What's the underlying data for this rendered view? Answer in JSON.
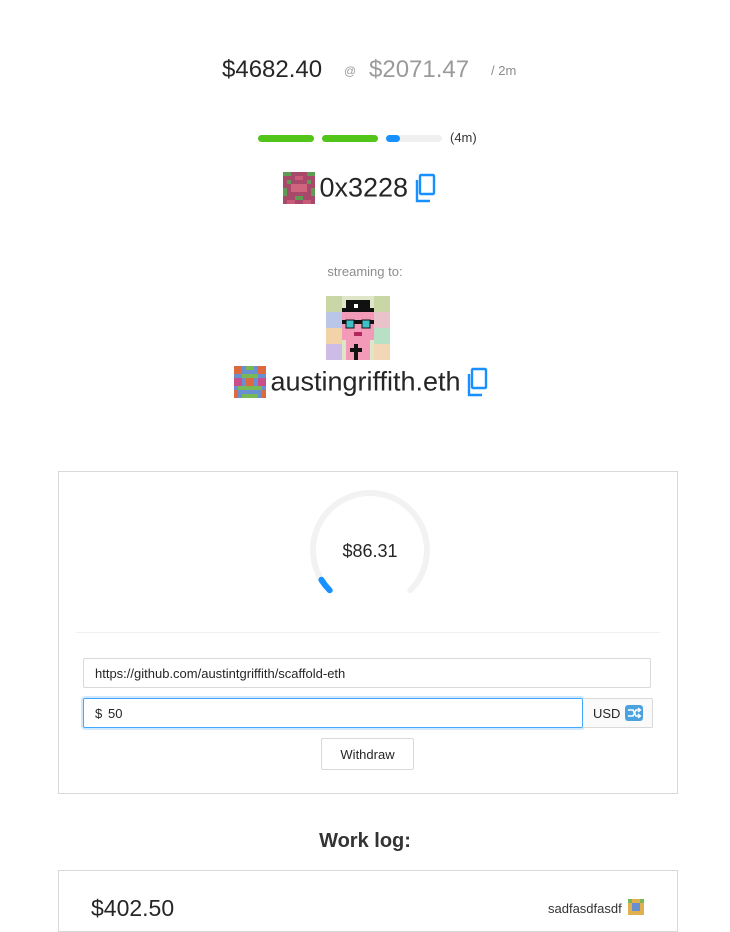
{
  "header": {
    "balance": "$4682.40",
    "at_symbol": "@",
    "rate": "$2071.47",
    "period": "/ 2m"
  },
  "progress": {
    "segments": [
      {
        "fill_fraction": 1.0,
        "color": "#52c41a"
      },
      {
        "fill_fraction": 1.0,
        "color": "#52c41a"
      },
      {
        "fill_fraction": 0.25,
        "color": "#1890ff"
      }
    ],
    "label": "(4m)"
  },
  "stream": {
    "address": "0x3228",
    "copy_icon": "copy-icon",
    "streaming_label": "streaming to:",
    "recipient_ens": "austingriffith.eth"
  },
  "widget": {
    "dial_amount": "$86.31",
    "dial_fraction": 0.05,
    "dial_color": "#1890ff",
    "url_value": "https://github.com/austintgriffith/scaffold-eth",
    "amount_prefix": "$",
    "amount_value": "50",
    "currency": "USD",
    "swap_icon": "shuffle-icon",
    "withdraw_label": "Withdraw"
  },
  "worklog": {
    "title": "Work log:",
    "entries": [
      {
        "amount": "$402.50",
        "note": "sadfasdfasdf"
      }
    ]
  },
  "colors": {
    "accent": "#1890ff",
    "success": "#52c41a",
    "muted": "#9a9a9a"
  }
}
